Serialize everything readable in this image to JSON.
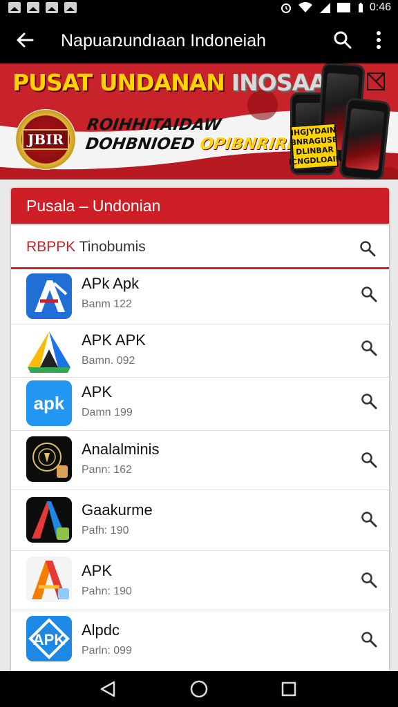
{
  "status_bar": {
    "time": "0:46",
    "icons": [
      "image-notification-icon",
      "image-notification-icon",
      "sync-notification-icon",
      "photo-notification-icon",
      "alarm-icon",
      "wifi-icon",
      "signal-icon",
      "battery-icon"
    ]
  },
  "app_bar": {
    "title": "Napuaռundıaan Indoneiah",
    "back_icon": "arrow-back-icon",
    "search_icon": "search-icon",
    "more_icon": "more-vert-icon"
  },
  "banner": {
    "headline": "PUSAT UNDANAN",
    "headline_grey": "INOSAA",
    "seal_text": "JBIR",
    "line1": "ROIHHITAIDAW",
    "line2": "DOHBNIOED",
    "line2_highlight": "OPIBNRIRIAS!",
    "sticker_lines": [
      "IHGJYDAIN",
      "BNRAGUSE",
      "DLINBAR",
      "ICNGDLOAIN"
    ],
    "colors": {
      "red": "#c8222a",
      "yellow": "#ffd400"
    }
  },
  "card": {
    "title": "Pusala – Undonian",
    "header_color": "#cf1f26",
    "search": {
      "prefix": "RBPPK",
      "text": "Tinobumis"
    },
    "items": [
      {
        "name": "APk Apk",
        "sub": "Banm 122"
      },
      {
        "name": "APK APK",
        "sub": "Bamn. 092"
      },
      {
        "name": "APK",
        "sub": "Damn 199"
      },
      {
        "name": "Analalminis",
        "sub": "Pann: 162"
      },
      {
        "name": "Gaakurme",
        "sub": "Pafh: 190"
      },
      {
        "name": "APK",
        "sub": "Pahn: 190"
      },
      {
        "name": "Alpdc",
        "sub": "Parln: 099"
      }
    ]
  },
  "nav_bar": {
    "icons": [
      "back-triangle-icon",
      "home-circle-icon",
      "recents-square-icon"
    ]
  }
}
